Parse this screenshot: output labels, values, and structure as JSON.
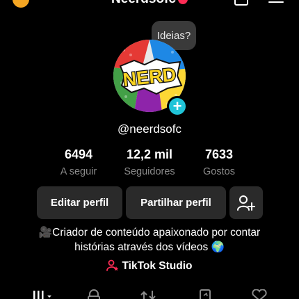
{
  "header": {
    "title": "Neerdsofc"
  },
  "tooltip": {
    "text": "Ideias?"
  },
  "avatar": {
    "logo_text": "NERD"
  },
  "profile": {
    "username": "@neerdsofc"
  },
  "stats": [
    {
      "value": "6494",
      "label": "A seguir"
    },
    {
      "value": "12,2 mil",
      "label": "Seguidores"
    },
    {
      "value": "7633",
      "label": "Gostos"
    }
  ],
  "actions": {
    "edit_label": "Editar perfil",
    "share_label": "Partilhar perfil"
  },
  "bio": {
    "line1": "🎥Criador de conteúdo apaixonado por contar",
    "line2": "histórias através dos vídeos 🌍"
  },
  "studio": {
    "label": "TikTok Studio"
  },
  "colors": {
    "accent_red": "#fe2c55",
    "plus_cyan": "#20c4d8",
    "button_bg": "#2a2a2a",
    "muted_text": "#8a8a8a"
  },
  "icons": {
    "top_left": "coin-icon",
    "top_right_1": "square-icon",
    "top_right_2": "menu-icon",
    "add_friend": "add-friend-icon",
    "tabs": [
      "grid-icon",
      "lock-icon",
      "repost-icon",
      "saved-icon",
      "liked-icon"
    ]
  }
}
